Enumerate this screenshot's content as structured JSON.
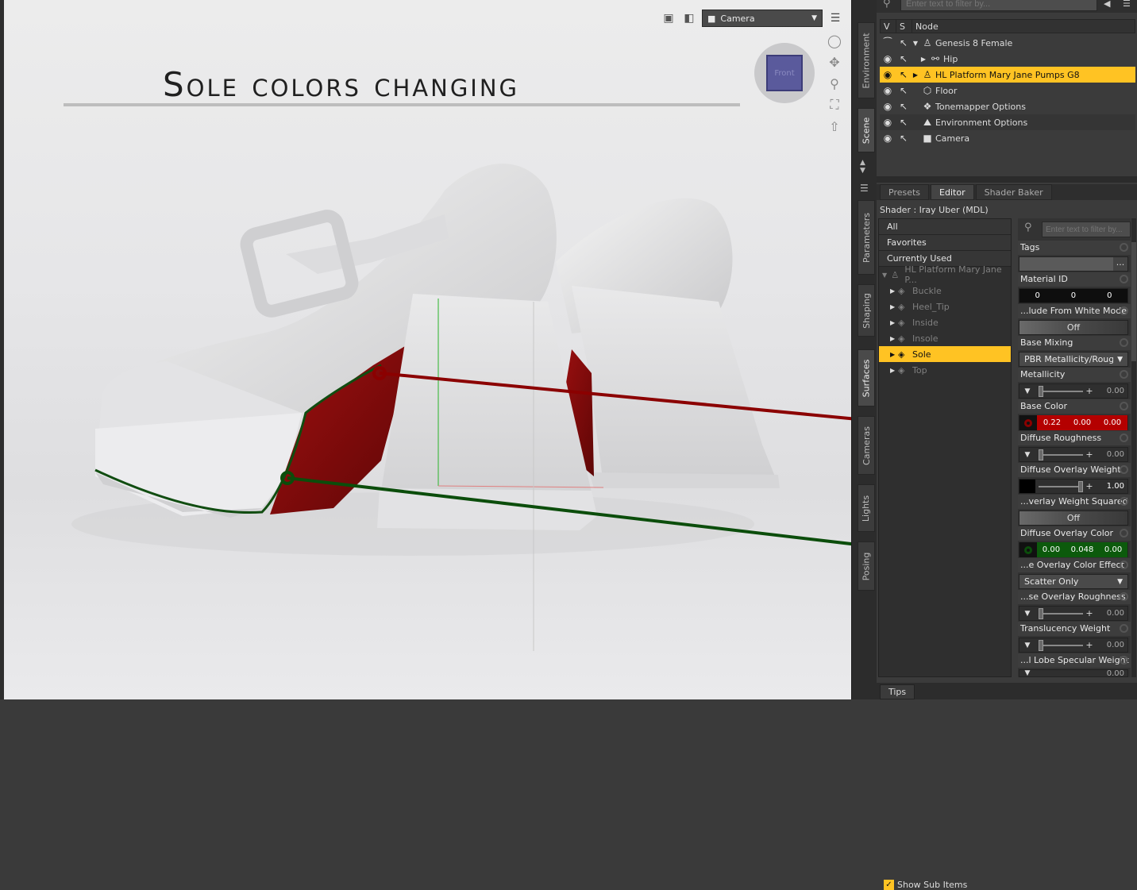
{
  "overlay": {
    "title": "Sole colors changing"
  },
  "viewport": {
    "camera_label": "Camera",
    "cube_face_label": "Front"
  },
  "scene": {
    "filter_placeholder": "Enter text to filter by...",
    "headers": {
      "v": "V",
      "s": "S",
      "node": "Node"
    },
    "nodes": [
      {
        "label": "Genesis 8 Female"
      },
      {
        "label": "Hip"
      },
      {
        "label": "HL Platform Mary Jane Pumps G8"
      },
      {
        "label": "Floor"
      },
      {
        "label": "Tonemapper Options"
      },
      {
        "label": "Environment Options"
      },
      {
        "label": "Camera"
      }
    ]
  },
  "side_tabs": [
    "Environment",
    "Scene",
    "Parameters",
    "Shaping",
    "Surfaces",
    "Cameras",
    "Lights",
    "Posing"
  ],
  "surface_tabs": [
    "Presets",
    "Editor",
    "Shader Baker"
  ],
  "shader_label": "Shader : Iray Uber (MDL)",
  "surface_list": {
    "groups": [
      "All",
      "Favorites",
      "Currently Used"
    ],
    "root": "HL Platform Mary Jane P...",
    "items": [
      "Buckle",
      "Heel_Tip",
      "Inside",
      "Insole",
      "Sole",
      "Top"
    ],
    "show_sub_items": "Show Sub Items"
  },
  "properties": {
    "filter_placeholder": "Enter text to filter by...",
    "tags": {
      "label": "Tags",
      "button": "..."
    },
    "material_id": {
      "label": "Material ID",
      "values": [
        "0",
        "0",
        "0"
      ]
    },
    "exclude_white": {
      "label": "...lude From White Mode",
      "value": "Off"
    },
    "base_mixing": {
      "label": "Base Mixing",
      "value": "PBR Metallicity/Roughness"
    },
    "metallicity": {
      "label": "Metallicity",
      "value": "0.00",
      "level": 0.0
    },
    "base_color": {
      "label": "Base Color",
      "values": [
        "0.22",
        "0.00",
        "0.00"
      ],
      "color": "#b40000"
    },
    "diffuse_roughness": {
      "label": "Diffuse Roughness",
      "value": "0.00",
      "level": 0.0
    },
    "diffuse_overlay_weight": {
      "label": "Diffuse Overlay Weight",
      "value": "1.00",
      "level": 1.0
    },
    "overlay_weight_squared": {
      "label": "...verlay Weight Squared",
      "value": "Off"
    },
    "diffuse_overlay_color": {
      "label": "Diffuse Overlay Color",
      "values": [
        "0.00",
        "0.048",
        "0.00"
      ],
      "color": "#0c5a0c"
    },
    "overlay_color_effect": {
      "label": "...e Overlay Color Effect",
      "value": "Scatter Only"
    },
    "overlay_roughness": {
      "label": "...se Overlay Roughness",
      "value": "0.00",
      "level": 0.0
    },
    "translucency_weight": {
      "label": "Translucency Weight",
      "value": "0.00",
      "level": 0.0
    },
    "lobe_specular_weight": {
      "label": "...l Lobe Specular Weight",
      "value": "0.00",
      "level": 0.0
    }
  },
  "footer": {
    "tips": "Tips"
  },
  "colors": {
    "accent": "#ffc323",
    "red_line": "#8b0000",
    "green_line": "#0b4d0b"
  }
}
